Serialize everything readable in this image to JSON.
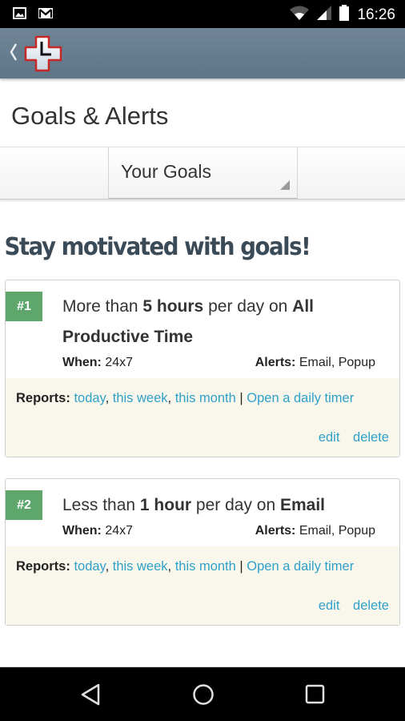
{
  "status_bar": {
    "left_icons": [
      "image-icon",
      "gmail-icon"
    ],
    "right_icons": [
      "wifi-icon",
      "signal-icon",
      "battery-icon"
    ],
    "time": "16:26"
  },
  "app_bar": {
    "back_icon": "chevron-left-icon",
    "logo": "rescuetime-clock-cross-logo"
  },
  "page": {
    "title": "Goals & Alerts"
  },
  "tabs": {
    "selected": "Your Goals"
  },
  "section": {
    "title": "Stay motivated with goals!"
  },
  "goals": [
    {
      "badge": "#1",
      "prefix": "More than ",
      "amount": "5 hours",
      "middle": " per day on ",
      "category": "All Productive Time",
      "when_label": "When:",
      "when_value": " 24x7",
      "alerts_label": "Alerts:",
      "alerts_value": " Email, Popup",
      "reports_label": "Reports:",
      "report_links": [
        "today",
        "this week",
        "this month"
      ],
      "separator": " | ",
      "timer_link": "Open a daily timer",
      "edit": "edit",
      "delete": "delete"
    },
    {
      "badge": "#2",
      "prefix": "Less than ",
      "amount": "1 hour",
      "middle": " per day on ",
      "category": "Email",
      "when_label": "When:",
      "when_value": " 24x7",
      "alerts_label": "Alerts:",
      "alerts_value": " Email, Popup",
      "reports_label": "Reports:",
      "report_links": [
        "today",
        "this week",
        "this month"
      ],
      "separator": " | ",
      "timer_link": "Open a daily timer",
      "edit": "edit",
      "delete": "delete"
    }
  ],
  "nav_bar": {
    "buttons": [
      "back-triangle-icon",
      "home-circle-icon",
      "recents-square-icon"
    ]
  },
  "colors": {
    "app_bar": "#6a8092",
    "badge": "#5fa66c",
    "link": "#2fa0c8",
    "report_bg": "#f9f7ec",
    "section_title": "#3b4a57"
  }
}
